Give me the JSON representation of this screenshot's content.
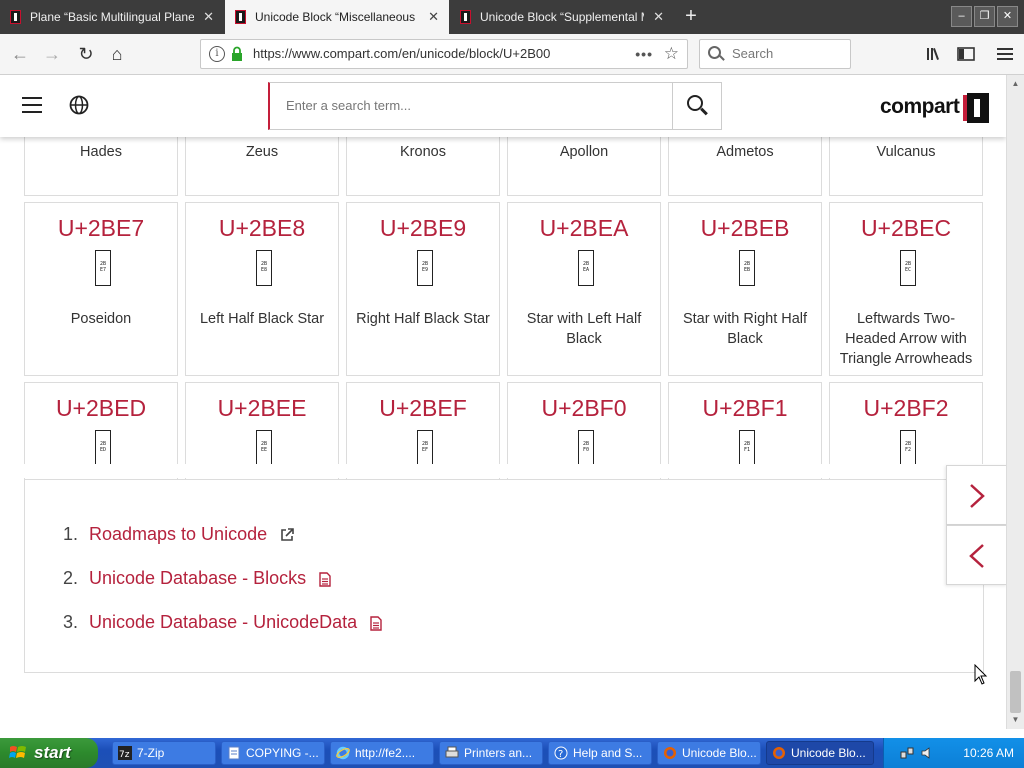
{
  "browser": {
    "tabs": [
      {
        "title": "Plane “Basic Multilingual Plane”",
        "active": false
      },
      {
        "title": "Unicode Block “Miscellaneous Symbols and Arrows”",
        "active": true
      },
      {
        "title": "Unicode Block “Supplemental Mathematical Operators”",
        "active": false
      }
    ],
    "url": "https://www.compart.com/en/unicode/block/U+2B00",
    "search_placeholder": "Search"
  },
  "site": {
    "search_placeholder": "Enter a search term...",
    "logo_text": "compart"
  },
  "grid": {
    "rows": [
      [
        {
          "code": "",
          "name": "Hades"
        },
        {
          "code": "",
          "name": "Zeus"
        },
        {
          "code": "",
          "name": "Kronos"
        },
        {
          "code": "",
          "name": "Apollon"
        },
        {
          "code": "",
          "name": "Admetos"
        },
        {
          "code": "",
          "name": "Vulcanus"
        }
      ],
      [
        {
          "code": "U+2BE7",
          "glyph": "2B E7",
          "name": "Poseidon"
        },
        {
          "code": "U+2BE8",
          "glyph": "2B E8",
          "name": "Left Half Black Star"
        },
        {
          "code": "U+2BE9",
          "glyph": "2B E9",
          "name": "Right Half Black Star"
        },
        {
          "code": "U+2BEA",
          "glyph": "2B EA",
          "name": "Star with Left Half Black"
        },
        {
          "code": "U+2BEB",
          "glyph": "2B EB",
          "name": "Star with Right Half Black"
        },
        {
          "code": "U+2BEC",
          "glyph": "2B EC",
          "name": "Leftwards Two-Headed Arrow with Triangle Arrowheads"
        }
      ],
      [
        {
          "code": "U+2BED",
          "glyph": "2B ED",
          "name": ""
        },
        {
          "code": "U+2BEE",
          "glyph": "2B EE",
          "name": ""
        },
        {
          "code": "U+2BEF",
          "glyph": "2B EF",
          "name": ""
        },
        {
          "code": "U+2BF0",
          "glyph": "2B F0",
          "name": ""
        },
        {
          "code": "U+2BF1",
          "glyph": "2B F1",
          "name": ""
        },
        {
          "code": "U+2BF2",
          "glyph": "2B F2",
          "name": ""
        }
      ]
    ]
  },
  "references": [
    {
      "num": "1.",
      "label": "Roadmaps to Unicode",
      "icon": "external-link-icon"
    },
    {
      "num": "2.",
      "label": "Unicode Database - Blocks",
      "icon": "document-icon"
    },
    {
      "num": "3.",
      "label": "Unicode Database - UnicodeData",
      "icon": "document-icon"
    }
  ],
  "nav_arrows": {
    "next": "next-arrow-icon",
    "previous": "previous-arrow-icon"
  },
  "taskbar": {
    "start_label": "start",
    "tasks": [
      {
        "label": "7-Zip",
        "active": false
      },
      {
        "label": "COPYING -...",
        "active": false
      },
      {
        "label": "http://fe2....",
        "active": false
      },
      {
        "label": "Printers an...",
        "active": false
      },
      {
        "label": "Help and S...",
        "active": false
      },
      {
        "label": "Unicode Blo...",
        "active": false
      },
      {
        "label": "Unicode Blo...",
        "active": true
      }
    ],
    "clock": "10:26 AM"
  },
  "colors": {
    "accent": "#b5223d",
    "brand_red": "#c41e3a",
    "taskbar_blue": "#1e50b4",
    "start_green": "#2d8a2d"
  }
}
